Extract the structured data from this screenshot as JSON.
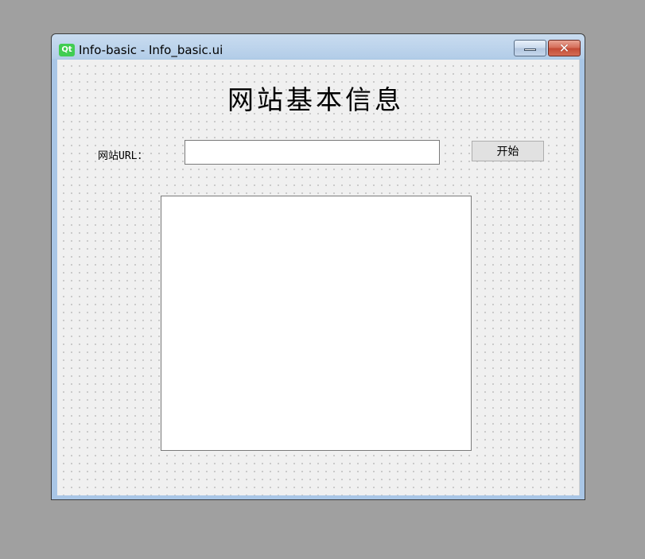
{
  "window": {
    "title": "Info-basic - Info_basic.ui",
    "app_icon": "Qt",
    "close_glyph": "✕"
  },
  "form": {
    "heading": "网站基本信息",
    "url_label": "网站URL：",
    "url_value": "",
    "start_button": "开始",
    "result_text": ""
  }
}
